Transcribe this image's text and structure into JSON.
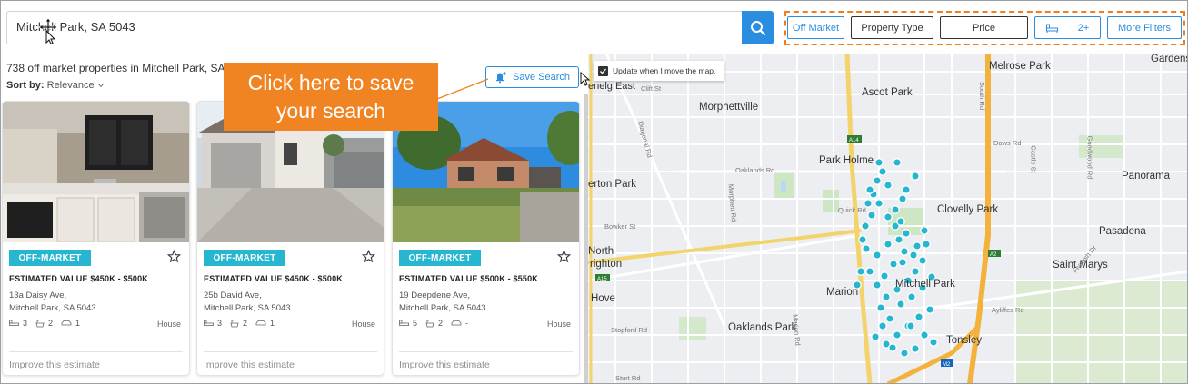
{
  "search": {
    "value": "Mitchell Park, SA 5043"
  },
  "filters": {
    "off_market": "Off Market",
    "property_type": "Property Type",
    "price": "Price",
    "beds": "2+",
    "more_filters": "More Filters"
  },
  "results": {
    "count_text": "738 off market properties in Mitchell Park, SA 5",
    "sort_label": "Sort by:",
    "sort_value": "Relevance"
  },
  "save_search": "Save Search",
  "callout": {
    "line1": "Click here to save",
    "line2": "your search"
  },
  "update_map": "Update when I move the map.",
  "cards": [
    {
      "badge": "OFF-MARKET",
      "estimate": "ESTIMATED VALUE $450K - $500K",
      "addr1": "13a Daisy Ave,",
      "addr2": "Mitchell Park, SA 5043",
      "beds": "3",
      "baths": "2",
      "cars": "1",
      "type": "House",
      "improve": "Improve this estimate"
    },
    {
      "badge": "OFF-MARKET",
      "estimate": "ESTIMATED VALUE $450K - $500K",
      "addr1": "25b David Ave,",
      "addr2": "Mitchell Park, SA 5043",
      "beds": "3",
      "baths": "2",
      "cars": "1",
      "type": "House",
      "improve": "Improve this estimate"
    },
    {
      "badge": "OFF-MARKET",
      "estimate": "ESTIMATED VALUE $500K - $550K",
      "addr1": "19 Deepdene Ave,",
      "addr2": "Mitchell Park, SA 5043",
      "beds": "5",
      "baths": "2",
      "cars": "-",
      "type": "House",
      "improve": "Improve this estimate"
    }
  ],
  "map": {
    "places": [
      "Melrose Park",
      "Gardens",
      "Ascot Park",
      "Morphettville",
      "Park Holme",
      "Panorama",
      "erton Park",
      "Clovelly Park",
      "Pasadena",
      "North",
      "righton",
      "Saint Marys",
      "Mitchell Park",
      "Marion",
      "Hove",
      "Oaklands Park",
      "Tonsley",
      "enelg East"
    ],
    "streets": [
      "Clift St",
      "Diagonal Rd",
      "Oaklands Rd",
      "Daws Rd",
      "Morphett Rd",
      "Bowker St",
      "Quick Rd",
      "Marion Rd",
      "Sturt Rd",
      "Stopford Rd",
      "South Rd",
      "Goodwood Rd",
      "Castle St",
      "Ayliffes Rd",
      "Fiveash Dr"
    ],
    "roads": [
      "A14",
      "A15",
      "A2",
      "M2"
    ]
  },
  "colors": {
    "accent": "#2a8de0",
    "badge": "#27b6cf",
    "callout": "#f08423",
    "filter_outline": "#ef7d1a"
  }
}
